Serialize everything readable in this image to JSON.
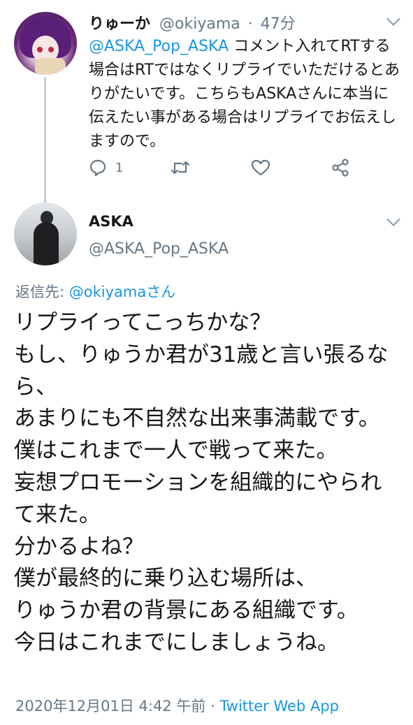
{
  "reply_tweet": {
    "display_name": "りゅーか",
    "handle": "@okiyama",
    "separator": "·",
    "time": "47分",
    "mention": "@ASKA_Pop_ASKA",
    "text": " コメント入れてRTする場合はRTではなくリプライでいただけるとありがたいです。こちらもASKAさんに本当に伝えたい事がある場合はリプライでお伝えしますので。",
    "reply_count": "1",
    "icons": {
      "reply": "reply-icon",
      "retweet": "retweet-icon",
      "like": "heart-icon",
      "share": "share-icon",
      "menu": "chevron-down-icon"
    }
  },
  "main_tweet": {
    "display_name": "ASKA",
    "handle": "@ASKA_Pop_ASKA",
    "replying_to_label": "返信先: ",
    "replying_to_user": "@okiyamaさん",
    "lines": [
      "リプライってこっちかな？",
      "もし、りゅうか君が31歳と言い張るなら、",
      "あまりにも不自然な出来事満載です。",
      "僕はこれまで一人で戦って来た。",
      "妄想プロモーションを組織的にやられて来た。",
      "分かるよね？",
      "僕が最終的に乗り込む場所は、",
      "りゅうか君の背景にある組織です。",
      "今日はこれまでにしましょうね。"
    ],
    "timestamp": "2020年12月01日 4:42 午前",
    "separator": " · ",
    "source": "Twitter Web App"
  },
  "colors": {
    "text": "#14171a",
    "muted": "#657786",
    "link": "#1b95e0",
    "thread_line": "#c4cfd6"
  }
}
